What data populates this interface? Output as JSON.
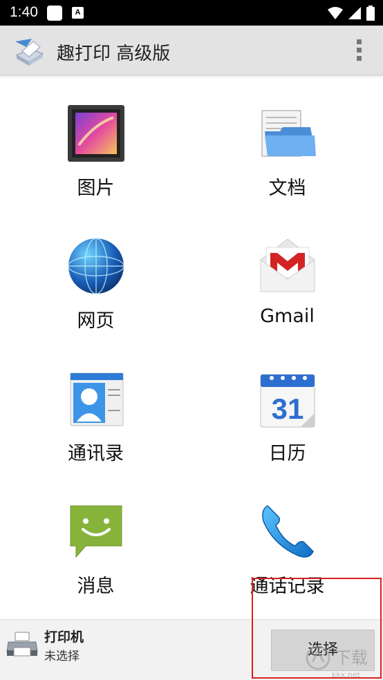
{
  "status_bar": {
    "time": "1:40",
    "icons": [
      "notification-square-icon",
      "a-badge-icon",
      "wifi-icon",
      "signal-icon",
      "battery-icon"
    ]
  },
  "app_bar": {
    "title": "趣打印 高级版",
    "logo_icon": "printer-paper-logo-icon",
    "menu_icon": "overflow-menu-icon"
  },
  "grid": [
    {
      "label": "图片",
      "icon": "photo-icon"
    },
    {
      "label": "文档",
      "icon": "folder-documents-icon"
    },
    {
      "label": "网页",
      "icon": "globe-icon"
    },
    {
      "label": "Gmail",
      "icon": "gmail-icon"
    },
    {
      "label": "通讯录",
      "icon": "contacts-icon"
    },
    {
      "label": "日历",
      "icon": "calendar-icon"
    },
    {
      "label": "消息",
      "icon": "message-icon"
    },
    {
      "label": "通话记录",
      "icon": "phone-icon"
    }
  ],
  "calendar_day": "31",
  "bottom_bar": {
    "printer_title": "打印机",
    "printer_status": "未选择",
    "select_button": "选择"
  },
  "watermark": {
    "text": "下载",
    "url_text": "kkx.net"
  },
  "colors": {
    "highlight_box": "#d9201e",
    "app_bar_bg": "#e3e3e3",
    "status_bar_bg": "#000000"
  }
}
